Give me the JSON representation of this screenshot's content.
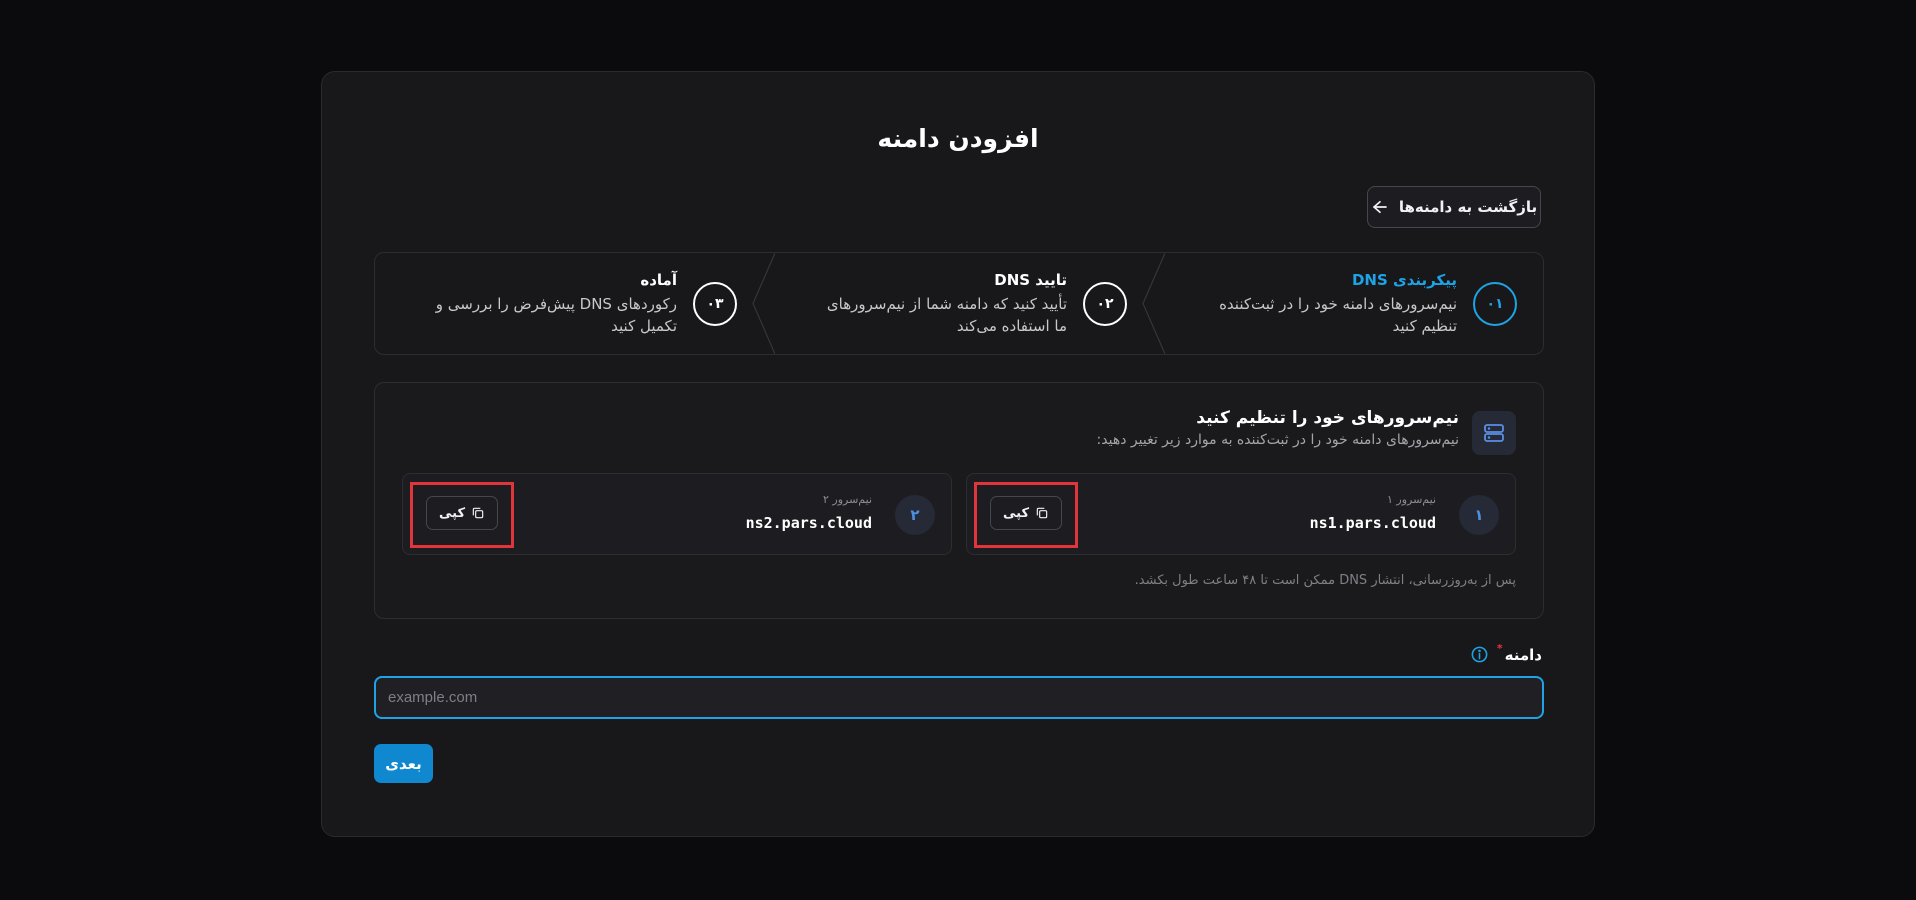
{
  "page": {
    "title": "افزودن دامنه",
    "back_label": "بازگشت به دامنه‌ها"
  },
  "steps": [
    {
      "number": "۰۱",
      "title": "پیکربندی DNS",
      "description": "نیم‌سرورهای دامنه خود را در ثبت‌کننده تنظیم کنید",
      "state": "active"
    },
    {
      "number": "۰۲",
      "title": "تایید DNS",
      "description": "تأیید کنید که دامنه شما از نیم‌سرورهای ما استفاده می‌کند",
      "state": "pending"
    },
    {
      "number": "۰۳",
      "title": "آماده",
      "description": "رکوردهای DNS پیش‌فرض را بررسی و تکمیل کنید",
      "state": "pending"
    }
  ],
  "nameservers": {
    "title": "نیم‌سرورهای خود را تنظیم کنید",
    "subtitle": "نیم‌سرورهای دامنه خود را در ثبت‌کننده به موارد زیر تغییر دهید:",
    "items": [
      {
        "index": "۱",
        "label": "نیم‌سرور ۱",
        "value": "ns1.pars.cloud",
        "copy_label": "کپی"
      },
      {
        "index": "۲",
        "label": "نیم‌سرور ۲",
        "value": "ns2.pars.cloud",
        "copy_label": "کپی"
      }
    ],
    "note": "پس از به‌روزرسانی، انتشار DNS ممکن است تا ۴۸ ساعت طول بکشد."
  },
  "domain_field": {
    "label": "دامنه",
    "required_mark": "*",
    "placeholder": "example.com",
    "value": ""
  },
  "next_label": "بعدی",
  "colors": {
    "accent": "#1ea3e6",
    "button": "#0f88cf",
    "highlight": "#e0353a"
  }
}
